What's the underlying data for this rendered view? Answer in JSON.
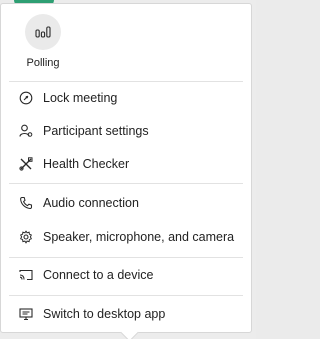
{
  "polling": {
    "label": "Polling",
    "icon": "polling-icon"
  },
  "menu_groups": [
    [
      {
        "label": "Lock meeting",
        "icon": "lock-meeting-icon"
      },
      {
        "label": "Participant settings",
        "icon": "participant-settings-icon"
      },
      {
        "label": "Health Checker",
        "icon": "health-checker-icon"
      }
    ],
    [
      {
        "label": "Audio connection",
        "icon": "phone-icon"
      },
      {
        "label": "Speaker, microphone, and camera",
        "icon": "gear-icon"
      }
    ],
    [
      {
        "label": "Connect to a device",
        "icon": "cast-icon"
      }
    ],
    [
      {
        "label": "Switch to desktop app",
        "icon": "desktop-app-icon"
      }
    ]
  ],
  "colors": {
    "accent": "#2e9f73",
    "text": "#222222",
    "divider": "#e2e2e2"
  }
}
